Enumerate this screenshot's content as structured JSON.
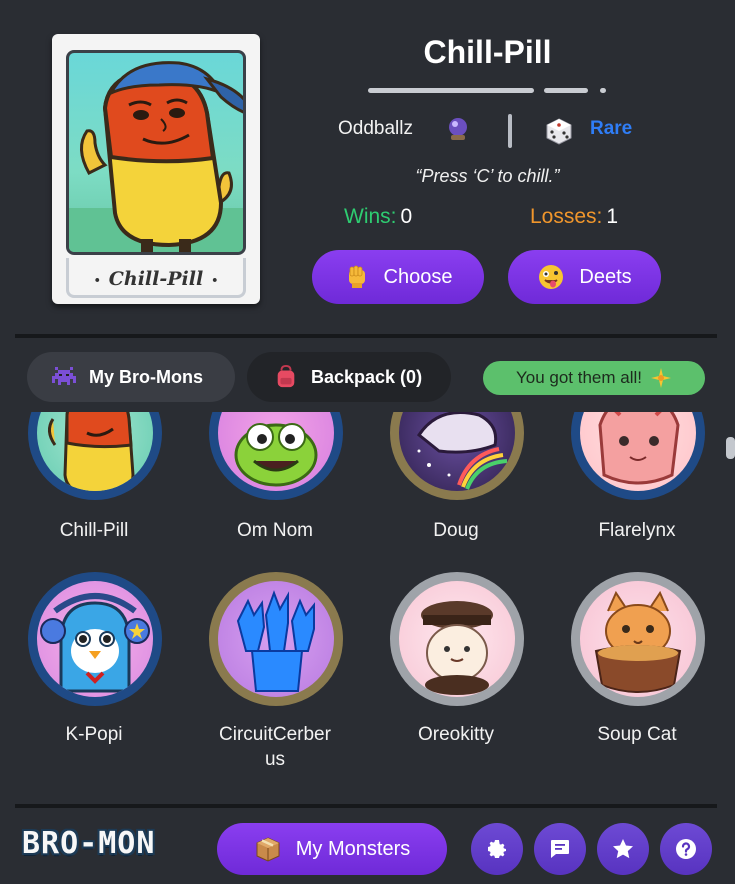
{
  "featured": {
    "card_caption": "Chill-Pill",
    "name": "Chill-Pill",
    "artist": "Oddballz",
    "rarity": "Rare",
    "tagline": "“Press ‘C’ to chill.”",
    "wins_label": "Wins:",
    "wins": "0",
    "losses_label": "Losses:",
    "losses": "1",
    "choose_label": "Choose",
    "deets_label": "Deets"
  },
  "tabs": {
    "my_bromons": "My Bro-Mons",
    "backpack": "Backpack (0)",
    "complete_badge": "You got them all!"
  },
  "monsters": [
    {
      "name": "Chill-Pill",
      "ring": "#1f4a86"
    },
    {
      "name": "Om Nom",
      "ring": "#1f4a86"
    },
    {
      "name": "Doug",
      "ring": "#8a7a4e"
    },
    {
      "name": "Flarelynx",
      "ring": "#1f4a86"
    },
    {
      "name": "K-Popi",
      "ring": "#1f4a86"
    },
    {
      "name": "CircuitCerberus",
      "name_line1": "CircuitCerber",
      "name_line2": "us",
      "ring": "#8a7a4e"
    },
    {
      "name": "Oreokitty",
      "ring": "#9fa3a9"
    },
    {
      "name": "Soup Cat",
      "ring": "#9fa3a9"
    }
  ],
  "footer": {
    "logo": "BRO-MON",
    "my_monsters": "My Monsters",
    "icons": [
      "gear-icon",
      "chat-icon",
      "star-icon",
      "help-icon"
    ]
  },
  "colors": {
    "background": "#2a2d33",
    "purple_button": "#7a34e6",
    "rare_blue": "#2f7df6",
    "wins_green": "#2ecc71",
    "losses_orange": "#f0962c",
    "badge_green": "#5cc06c"
  }
}
